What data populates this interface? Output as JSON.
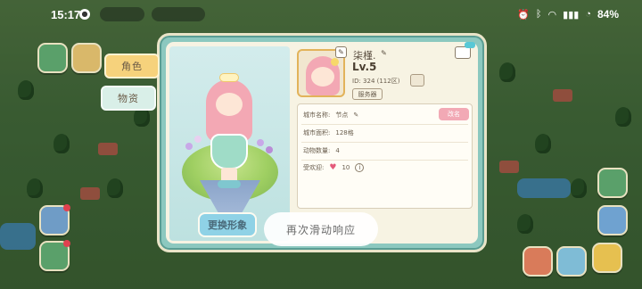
{
  "status_bar": {
    "time": "15:17",
    "battery": "84%"
  },
  "tabs": {
    "role": "角色",
    "goods": "物资"
  },
  "character": {
    "change_outfit": "更换形象"
  },
  "profile": {
    "name": "柒槿.",
    "level": "Lv.5",
    "uid": "ID: 324 (112区)",
    "server_button": "服务器"
  },
  "info": {
    "city_name_label": "城市名称:",
    "city_name_value": "节点",
    "city_area_label": "城市面积:",
    "city_area_value": "128格",
    "animal_count_label": "动物数量:",
    "animal_count_value": "4",
    "popularity_label": "受欢迎:",
    "popularity_value": "10",
    "rename_button": "改名"
  },
  "toast": {
    "text": "再次滑动响应"
  },
  "colors": {
    "modal_frame": "#8cc8bf",
    "tab_active": "#f6d27c",
    "rename_button": "#f2a9b5",
    "outfit_button": "#8fd2e6"
  }
}
